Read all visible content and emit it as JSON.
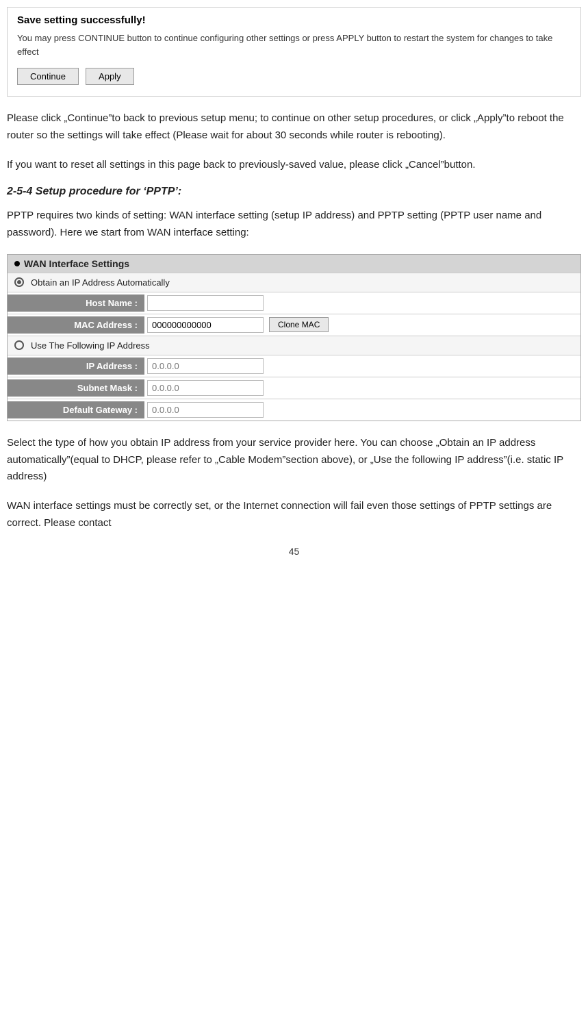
{
  "save_box": {
    "title": "Save setting successfully!",
    "description": "You may press CONTINUE button to continue configuring other settings or press APPLY button to restart the system for changes to take effect",
    "continue_label": "Continue",
    "apply_label": "Apply"
  },
  "paragraphs": {
    "p1": "Please click „Continue”to back to previous setup menu; to continue on other setup procedures, or click „Apply”to reboot the router so the settings will take effect (Please wait for about 30 seconds while router is rebooting).",
    "p2": "If you want to reset all settings in this page back to previously-saved value, please click „Cancel”button.",
    "section_heading": "2-5-4 Setup procedure for ‘PPTP’:",
    "p3": "PPTP requires two kinds of setting: WAN interface setting (setup IP address) and PPTP setting (PPTP user name and password). Here we start from WAN interface setting:",
    "p4": "Select the type of how you obtain IP address from your service provider here. You can choose „Obtain an IP address automatically”(equal to DHCP, please refer to „Cable Modem”section above), or „Use the following IP address”(i.e. static IP address)",
    "p5": "WAN interface settings must be correctly set, or the Internet connection will fail even those settings of PPTP settings are correct. Please contact"
  },
  "wan": {
    "header": "WAN Interface Settings",
    "radio1_label": "Obtain an IP Address Automatically",
    "host_name_label": "Host Name :",
    "host_name_value": "",
    "host_name_placeholder": "",
    "mac_address_label": "MAC Address :",
    "mac_address_value": "000000000000",
    "clone_mac_label": "Clone MAC",
    "radio2_label": "Use The Following IP Address",
    "ip_address_label": "IP Address :",
    "ip_address_placeholder": "0.0.0.0",
    "subnet_mask_label": "Subnet Mask :",
    "subnet_mask_placeholder": "0.0.0.0",
    "default_gateway_label": "Default Gateway :",
    "default_gateway_placeholder": "0.0.0.0"
  },
  "page_number": "45"
}
